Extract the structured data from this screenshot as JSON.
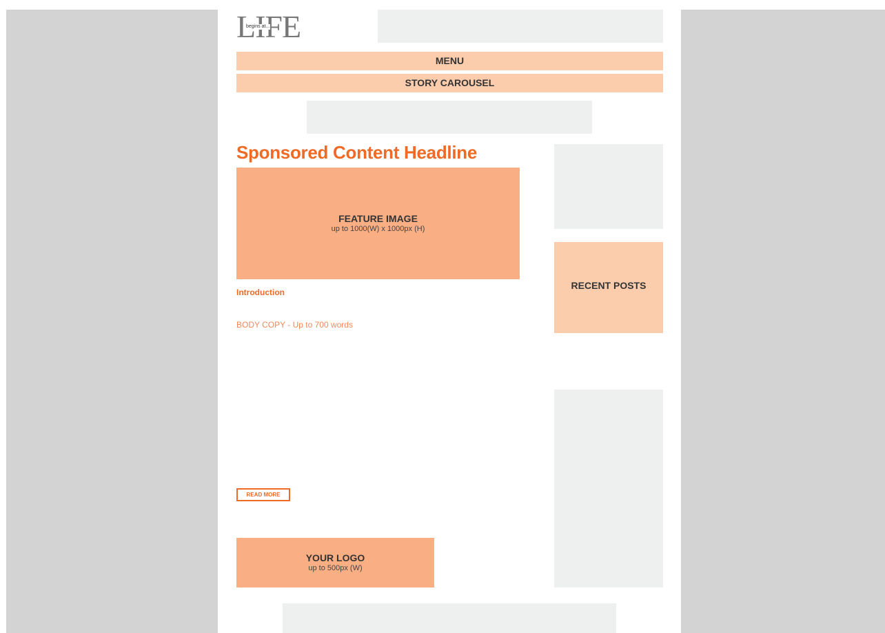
{
  "logo": {
    "main": "LIFE",
    "tagline": "begins at..."
  },
  "nav": {
    "menu_label": "MENU",
    "carousel_label": "STORY CAROUSEL"
  },
  "article": {
    "headline": "Sponsored Content Headline",
    "feature_image": {
      "title": "FEATURE IMAGE",
      "subtitle": "up to 1000(W) x 1000px (H)"
    },
    "intro": "Introduction",
    "body": "BODY COPY - Up to 700 words",
    "read_more": "READ MORE",
    "logo_box": {
      "title": "YOUR LOGO",
      "subtitle": "up to 500px (W)"
    }
  },
  "sidebar": {
    "recent_posts": "RECENT POSTS"
  },
  "colors": {
    "accent": "#ee6a25",
    "peach_light": "#fbcdad",
    "peach": "#f9ae84",
    "placeholder_gray": "#eef0ef",
    "page_margin_gray": "#d3d3d3"
  }
}
